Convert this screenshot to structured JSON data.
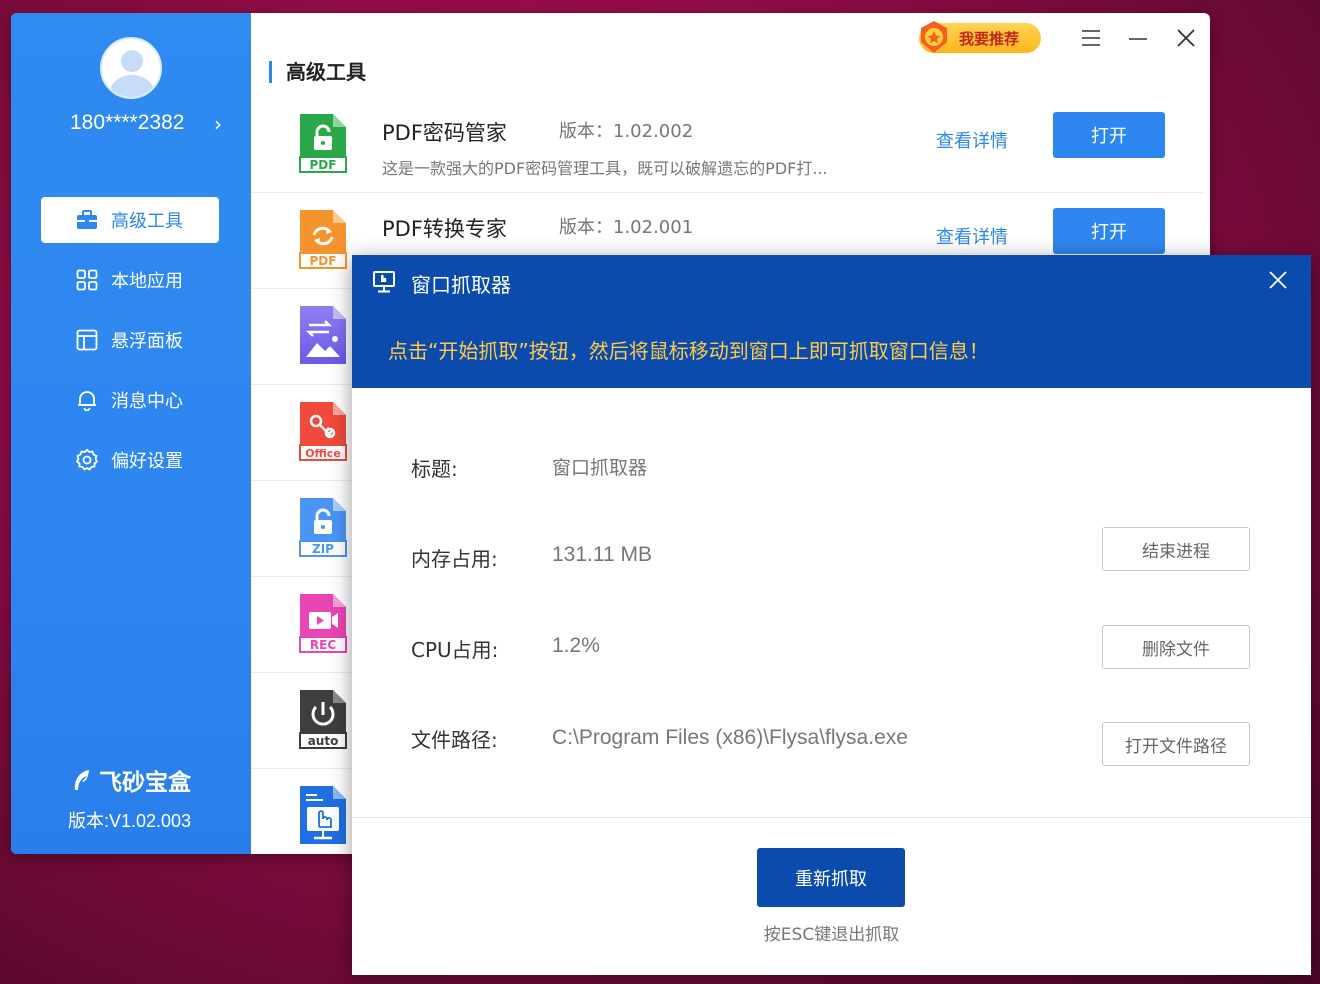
{
  "sidebar": {
    "user_phone": "180****2382",
    "user_arrow": "›",
    "items": [
      {
        "label": "高级工具",
        "active": true
      },
      {
        "label": "本地应用",
        "active": false
      },
      {
        "label": "悬浮面板",
        "active": false
      },
      {
        "label": "消息中心",
        "active": false
      },
      {
        "label": "偏好设置",
        "active": false
      }
    ],
    "brand": "飞砂宝盒",
    "version": "版本:V1.02.003"
  },
  "header": {
    "recommend_label": "我要推荐"
  },
  "content": {
    "section_title": "高级工具",
    "tools": [
      {
        "name": "PDF密码管家",
        "version": "版本：1.02.002",
        "desc": "这是一款强大的PDF密码管理工具，既可以破解遗忘的PDF打...",
        "detail": "查看详情",
        "open": "打开",
        "icon_text": "PDF",
        "color": "#2aa84a"
      },
      {
        "name": "PDF转换专家",
        "version": "版本：1.02.001",
        "desc": "",
        "detail": "查看详情",
        "open": "打开",
        "icon_text": "PDF",
        "color": "#f7932f"
      },
      {
        "name": "",
        "icon_text": "",
        "color": "#7b6cf0"
      },
      {
        "name": "",
        "icon_text": "Office",
        "color": "#f04a3c"
      },
      {
        "name": "",
        "icon_text": "ZIP",
        "color": "#4a95f5"
      },
      {
        "name": "",
        "icon_text": "REC",
        "color": "#e945b4"
      },
      {
        "name": "",
        "icon_text": "auto",
        "color": "#3e3e3e"
      },
      {
        "name": "",
        "icon_text": "",
        "color": "#1f6fe3"
      }
    ]
  },
  "dialog": {
    "title": "窗口抓取器",
    "hint": "点击“开始抓取”按钮，然后将鼠标移动到窗口上即可抓取窗口信息！",
    "fields": {
      "title_label": "标题:",
      "title_value": "窗口抓取器",
      "memory_label": "内存占用:",
      "memory_value": "131.11 MB",
      "cpu_label": "CPU占用:",
      "cpu_value": "1.2%",
      "path_label": "文件路径:",
      "path_value": "C:\\Program Files (x86)\\Flysa\\flysa.exe"
    },
    "buttons": {
      "end_process": "结束进程",
      "delete_file": "删除文件",
      "open_path": "打开文件路径",
      "recapture": "重新抓取"
    },
    "esc_hint": "按ESC键退出抓取"
  },
  "colors": {
    "sidebar_blue": "#2e86f0",
    "dialog_blue": "#0b4bae",
    "hint_yellow": "#ffcc47"
  }
}
